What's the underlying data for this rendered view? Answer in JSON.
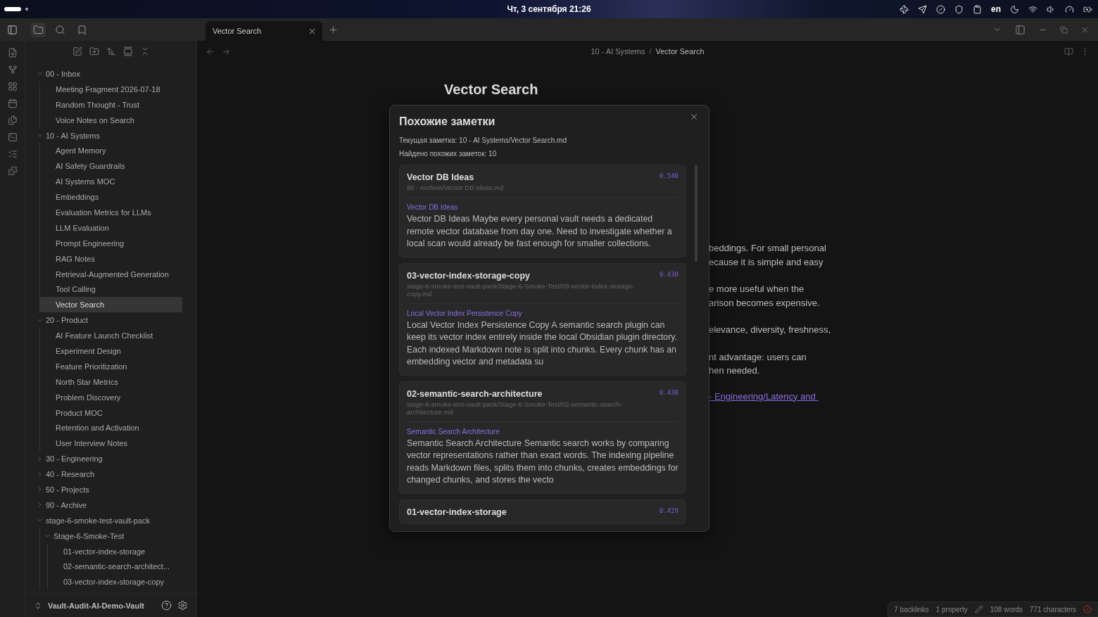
{
  "system_bar": {
    "clock": "Чт, 3 сентября 21:26",
    "keyboard_layout": "en"
  },
  "tabs": [
    {
      "label": "Vector Search",
      "selected": true
    }
  ],
  "breadcrumb": {
    "separator": "/",
    "items": [
      "10 - AI Systems",
      "Vector Search"
    ]
  },
  "tree": [
    {
      "label": "00 - Inbox",
      "kind": "folder",
      "expanded": true,
      "children": [
        {
          "label": "Meeting Fragment 2026-07-18",
          "kind": "file",
          "selected": false
        },
        {
          "label": "Random Thought - Trust",
          "kind": "file",
          "selected": false
        },
        {
          "label": "Voice Notes on Search",
          "kind": "file",
          "selected": false
        }
      ]
    },
    {
      "label": "10 - AI Systems",
      "kind": "folder",
      "expanded": true,
      "children": [
        {
          "label": "Agent Memory",
          "kind": "file",
          "selected": false
        },
        {
          "label": "AI Safety Guardrails",
          "kind": "file",
          "selected": false
        },
        {
          "label": "AI Systems MOC",
          "kind": "file",
          "selected": false
        },
        {
          "label": "Embeddings",
          "kind": "file",
          "selected": false
        },
        {
          "label": "Evaluation Metrics for LLMs",
          "kind": "file",
          "selected": false
        },
        {
          "label": "LLM Evaluation",
          "kind": "file",
          "selected": false
        },
        {
          "label": "Prompt Engineering",
          "kind": "file",
          "selected": false
        },
        {
          "label": "RAG Notes",
          "kind": "file",
          "selected": false
        },
        {
          "label": "Retrieval-Augmented Generation",
          "kind": "file",
          "selected": false
        },
        {
          "label": "Tool Calling",
          "kind": "file",
          "selected": false
        },
        {
          "label": "Vector Search",
          "kind": "file",
          "selected": true
        }
      ]
    },
    {
      "label": "20 - Product",
      "kind": "folder",
      "expanded": true,
      "children": [
        {
          "label": "AI Feature Launch Checklist",
          "kind": "file",
          "selected": false
        },
        {
          "label": "Experiment Design",
          "kind": "file",
          "selected": false
        },
        {
          "label": "Feature Prioritization",
          "kind": "file",
          "selected": false
        },
        {
          "label": "North Star Metrics",
          "kind": "file",
          "selected": false
        },
        {
          "label": "Problem Discovery",
          "kind": "file",
          "selected": false
        },
        {
          "label": "Product MOC",
          "kind": "file",
          "selected": false
        },
        {
          "label": "Retention and Activation",
          "kind": "file",
          "selected": false
        },
        {
          "label": "User Interview Notes",
          "kind": "file",
          "selected": false
        }
      ]
    },
    {
      "label": "30 - Engineering",
      "kind": "folder",
      "expanded": false
    },
    {
      "label": "40 - Research",
      "kind": "folder",
      "expanded": false
    },
    {
      "label": "50 - Projects",
      "kind": "folder",
      "expanded": false
    },
    {
      "label": "90 - Archive",
      "kind": "folder",
      "expanded": false
    },
    {
      "label": "stage-6-smoke-test-vault-pack",
      "kind": "folder",
      "expanded": true,
      "children": [
        {
          "label": "Stage-6-Smoke-Test",
          "kind": "folder",
          "expanded": true,
          "children": [
            {
              "label": "01-vector-index-storage",
              "kind": "file",
              "selected": false
            },
            {
              "label": "02-semantic-search-architect...",
              "kind": "file",
              "selected": false
            },
            {
              "label": "03-vector-index-storage-copy",
              "kind": "file",
              "selected": false
            }
          ]
        }
      ]
    }
  ],
  "vault_name": "Vault-Audit-AI-Demo-Vault",
  "note": {
    "title": "Vector Search",
    "paragraphs": [
      {
        "kind": "text",
        "lines": [
          "beddings. For small personal",
          "ecause it is simple and easy"
        ]
      },
      {
        "kind": "text",
        "lines": [
          "e more useful when the",
          "arison becomes expensive."
        ]
      },
      {
        "kind": "text",
        "lines": [
          "elevance, diversity, freshness,"
        ]
      },
      {
        "kind": "text",
        "lines": [
          "nt advantage: users can",
          "hen needed."
        ]
      },
      {
        "kind": "link",
        "lines": [
          "- Engineering/Latency and "
        ]
      }
    ]
  },
  "modal": {
    "title": "Похожие заметки",
    "current_note": "Текущая заметка: 10 - AI Systems/Vector Search.md",
    "found_count": "Найдено похожих заметок: 10",
    "results": [
      {
        "title": "Vector DB Ideas",
        "score": "0.540",
        "path": "90 - Archive/Vector DB Ideas.md",
        "heading": "Vector DB Ideas",
        "snippet": "Vector DB Ideas Maybe every personal vault needs a dedicated remote vector database from day one. Need to investigate whether a local scan would already be fast enough for smaller collections."
      },
      {
        "title": "03-vector-index-storage-copy",
        "score": "0.430",
        "path": "stage-6-smoke-test-vault-pack/Stage-6-Smoke-Test/03-vector-index-storage-copy.md",
        "heading": "Local Vector Index Persistence Copy",
        "snippet": "Local Vector Index Persistence Copy A semantic search plugin can keep its vector index entirely inside the local Obsidian plugin directory. Each indexed Markdown note is split into chunks. Every chunk has an embedding vector and metadata su"
      },
      {
        "title": "02-semantic-search-architecture",
        "score": "0.430",
        "path": "stage-6-smoke-test-vault-pack/Stage-6-Smoke-Test/02-semantic-search-architecture.md",
        "heading": "Semantic Search Architecture",
        "snippet": "Semantic Search Architecture Semantic search works by comparing vector representations rather than exact words. The indexing pipeline reads Markdown files, splits them into chunks, creates embeddings for changed chunks, and stores the vecto"
      },
      {
        "title": "01-vector-index-storage",
        "score": "0.429"
      }
    ]
  },
  "status_bar": {
    "backlinks": "7 backlinks",
    "properties": "1 property",
    "words": "108 words",
    "characters": "771 characters"
  }
}
